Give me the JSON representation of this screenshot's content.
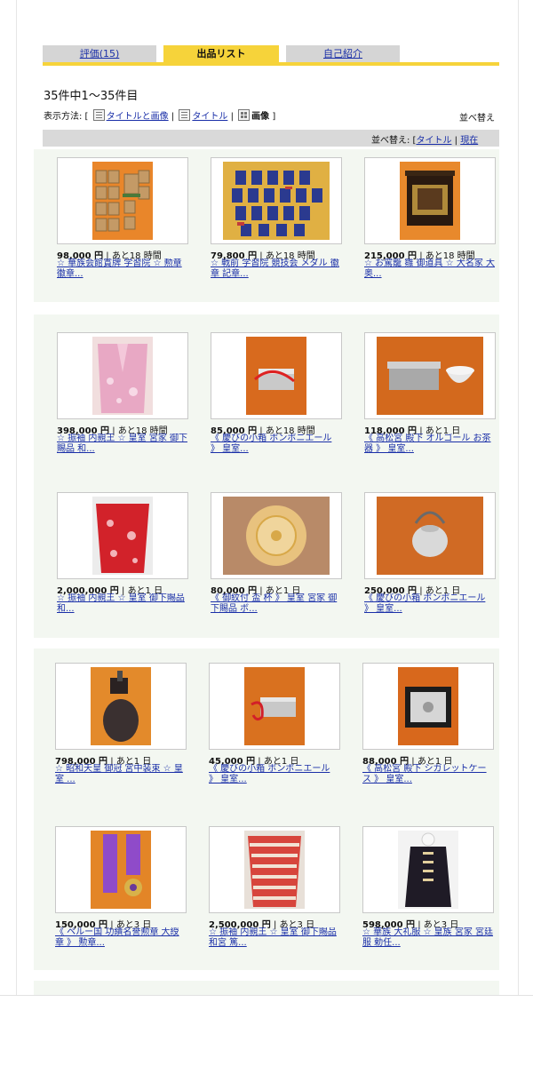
{
  "tabs": [
    {
      "label": "評価(15)"
    },
    {
      "label": "出品リスト"
    },
    {
      "label": "自己紹介"
    }
  ],
  "summary": {
    "count_text": "35件中1〜35件目"
  },
  "view_options": {
    "label": "表示方法: [",
    "option1": "タイトルと画像",
    "sep1": "|",
    "option2": "タイトル",
    "sep2": "|",
    "option3": "画像",
    "close": "]",
    "sort_label": "並べ替え"
  },
  "sortbar": {
    "label": "並べ替え: [",
    "option1": "タイトル",
    "sep": "|",
    "option2": "現在"
  },
  "items": [
    {
      "price": "98,000 円",
      "time": "| あと18 時間",
      "title": "☆ 華族会館賞牌 学習院 ☆ 勲章 徽章..."
    },
    {
      "price": "79,800 円",
      "time": "| あと18 時間",
      "title": "☆ 戦前 学習院 競技会 メダル 徽章 記章..."
    },
    {
      "price": "215,000 円",
      "time": "| あと18 時間",
      "title": "☆ お駕籠 雛 御道具 ☆ 大名家 大奥..."
    },
    {
      "price": "398,000 円",
      "time": "| あと18 時間",
      "title": "☆ 振袖 内親王 ☆ 皇室 宮家 御下賜品 和..."
    },
    {
      "price": "85,000 円",
      "time": "| あと18 時間",
      "title": "《 慶びの小箱 ボンボニエール 》 皇室..."
    },
    {
      "price": "118,000 円",
      "time": "| あと1 日",
      "title": "《 高松宮 殿下 オルゴール お茶器 》 皇室..."
    },
    {
      "price": "2,000,000 円",
      "time": "| あと1 日",
      "title": "☆ 振袖 内親王 ☆ 皇室 御下賜品 和..."
    },
    {
      "price": "80,000 円",
      "time": "| あと1 日",
      "title": "《 御紋付 盃 杯 》 皇室 宮家 御下賜品 ボ..."
    },
    {
      "price": "250,000 円",
      "time": "| あと1 日",
      "title": "《 慶びの小箱 ボンボニエール 》 皇室..."
    },
    {
      "price": "798,000 円",
      "time": "| あと1 日",
      "title": "☆ 昭和天皇 御冠 宮中装束 ☆ 皇室 ..."
    },
    {
      "price": "45,000 円",
      "time": "| あと1 日",
      "title": "《 慶びの小箱 ボンボニエール 》 皇室..."
    },
    {
      "price": "88,000 円",
      "time": "| あと1 日",
      "title": "《 高松宮 殿下 シガレットケース 》 皇室..."
    },
    {
      "price": "150,000 円",
      "time": "| あと3 日",
      "title": "《 ペルー国 功績名誉勲章 大綬章 》 勲章..."
    },
    {
      "price": "2,500,000 円",
      "time": "| あと3 日",
      "title": "☆ 振袖 内親王 ☆ 皇室 御下賜品 和宮 篤..."
    },
    {
      "price": "598,000 円",
      "time": "| あと3 日",
      "title": "☆ 華族 大礼服 ☆ 皇族 宮家 宮廷服 勅任..."
    }
  ],
  "colors": {
    "tab_active": "#f6d33a",
    "tab_inactive": "#d5d5d5",
    "link": "#1a2fa8",
    "block_bg": "#f3f7f1",
    "sortbar_bg": "#d9d9d9"
  }
}
